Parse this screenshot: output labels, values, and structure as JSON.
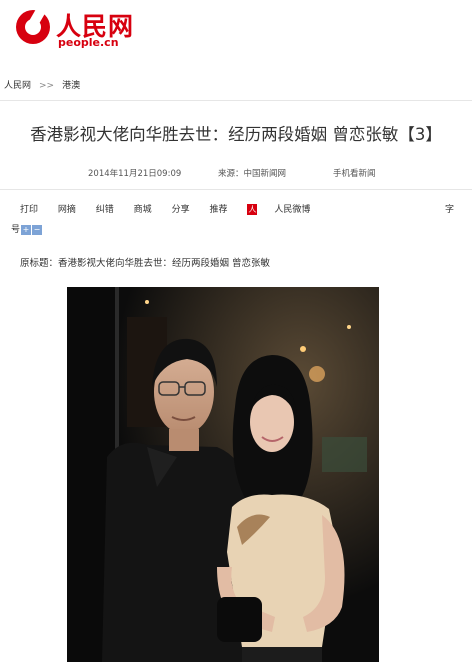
{
  "header": {
    "logo_cn": "人民网",
    "logo_en": "people.cn"
  },
  "breadcrumb": {
    "home": "人民网",
    "separator": ">>",
    "section": "港澳"
  },
  "article": {
    "title": "香港影视大佬向华胜去世：经历两段婚姻 曾恋张敏【3】",
    "date": "2014年11月21日09:09",
    "source_label": "来源：",
    "source": "中国新闻网",
    "mobile": "手机看新闻",
    "original_title": "原标题：香港影视大佬向华胜去世：经历两段婚姻 曾恋张敏"
  },
  "toolbar": {
    "items": [
      "打印",
      "网摘",
      "纠错",
      "商城",
      "分享",
      "推荐"
    ],
    "weibo_label": "人民微博",
    "font_label_1": "字",
    "font_label_2": "号",
    "font_plus": "+",
    "font_minus": "−"
  },
  "colors": {
    "brand": "#d7000f",
    "font_button": "#7da3d6"
  }
}
